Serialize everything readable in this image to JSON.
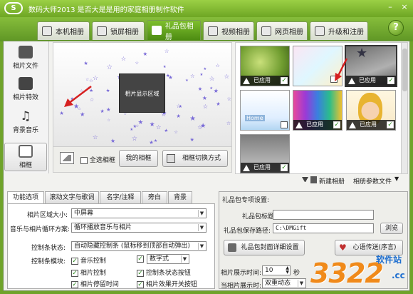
{
  "window": {
    "logo_text": "S",
    "title": "数码大师2013   是否大是是用的家庭相册制作软件",
    "controls": [
      "–",
      "×"
    ]
  },
  "tabs": [
    {
      "label": "本机相册"
    },
    {
      "label": "锁屏相册"
    },
    {
      "label": "礼品包相册"
    },
    {
      "label": "视频相册"
    },
    {
      "label": "网页相册"
    },
    {
      "label": "升级和注册"
    }
  ],
  "help": "?",
  "leftnav": [
    {
      "label": "相片文件"
    },
    {
      "label": "相片特效"
    },
    {
      "label": "背景音乐"
    },
    {
      "label": "相框"
    }
  ],
  "stage": {
    "placeholder": "相片显示区域"
  },
  "stage_tools": {
    "select_all": "全选相框",
    "my_frames": "我的相框",
    "switch_mode": "相框切换方式"
  },
  "thumbnails": {
    "applied_label": "已应用",
    "home_label": "Home"
  },
  "thumb_status": {
    "new_album": "新建相册",
    "album_params": "相册参数文件"
  },
  "subtabs": [
    {
      "label": "功能选项"
    },
    {
      "label": "滚动文字与歌词"
    },
    {
      "label": "名字/注释"
    },
    {
      "label": "旁白"
    },
    {
      "label": "背景"
    }
  ],
  "options": {
    "area_size_label": "相片区域大小:",
    "area_size_value": "中屏幕",
    "loop_label": "音乐与相片循环方案:",
    "loop_value": "循环播放音乐与相片",
    "control_status_label": "控制条状态:",
    "control_status_value": "自动隐藏控制条 (鼠标移到顶部自动弹出)",
    "control_module_label": "控制条模块:",
    "checks": [
      {
        "label": "音乐控制"
      },
      {
        "label": "相片控制"
      },
      {
        "label": "相片停留时间"
      },
      {
        "label": "数字式"
      },
      {
        "label": "控制条状态按钮"
      },
      {
        "label": "相片效果开关按钮"
      }
    ]
  },
  "gift": {
    "header": "礼品包专项设置:",
    "title_label": "礼品包标题:",
    "title_value": "",
    "save_path_label": "礼品包保存路径:",
    "save_path_value": "C:\\DMGift",
    "browse": "浏览",
    "cover_button": "礼品包封面详细设置",
    "heart_button": "心语传送(序言)",
    "display_time_label": "相片展示时间:",
    "display_time_value": "10",
    "seconds": "秒",
    "current_display_label": "当相片展示时:",
    "current_display_value": "双重动态"
  },
  "watermark": {
    "big": "3322",
    "site": "软件站",
    "domain": ".cc"
  }
}
